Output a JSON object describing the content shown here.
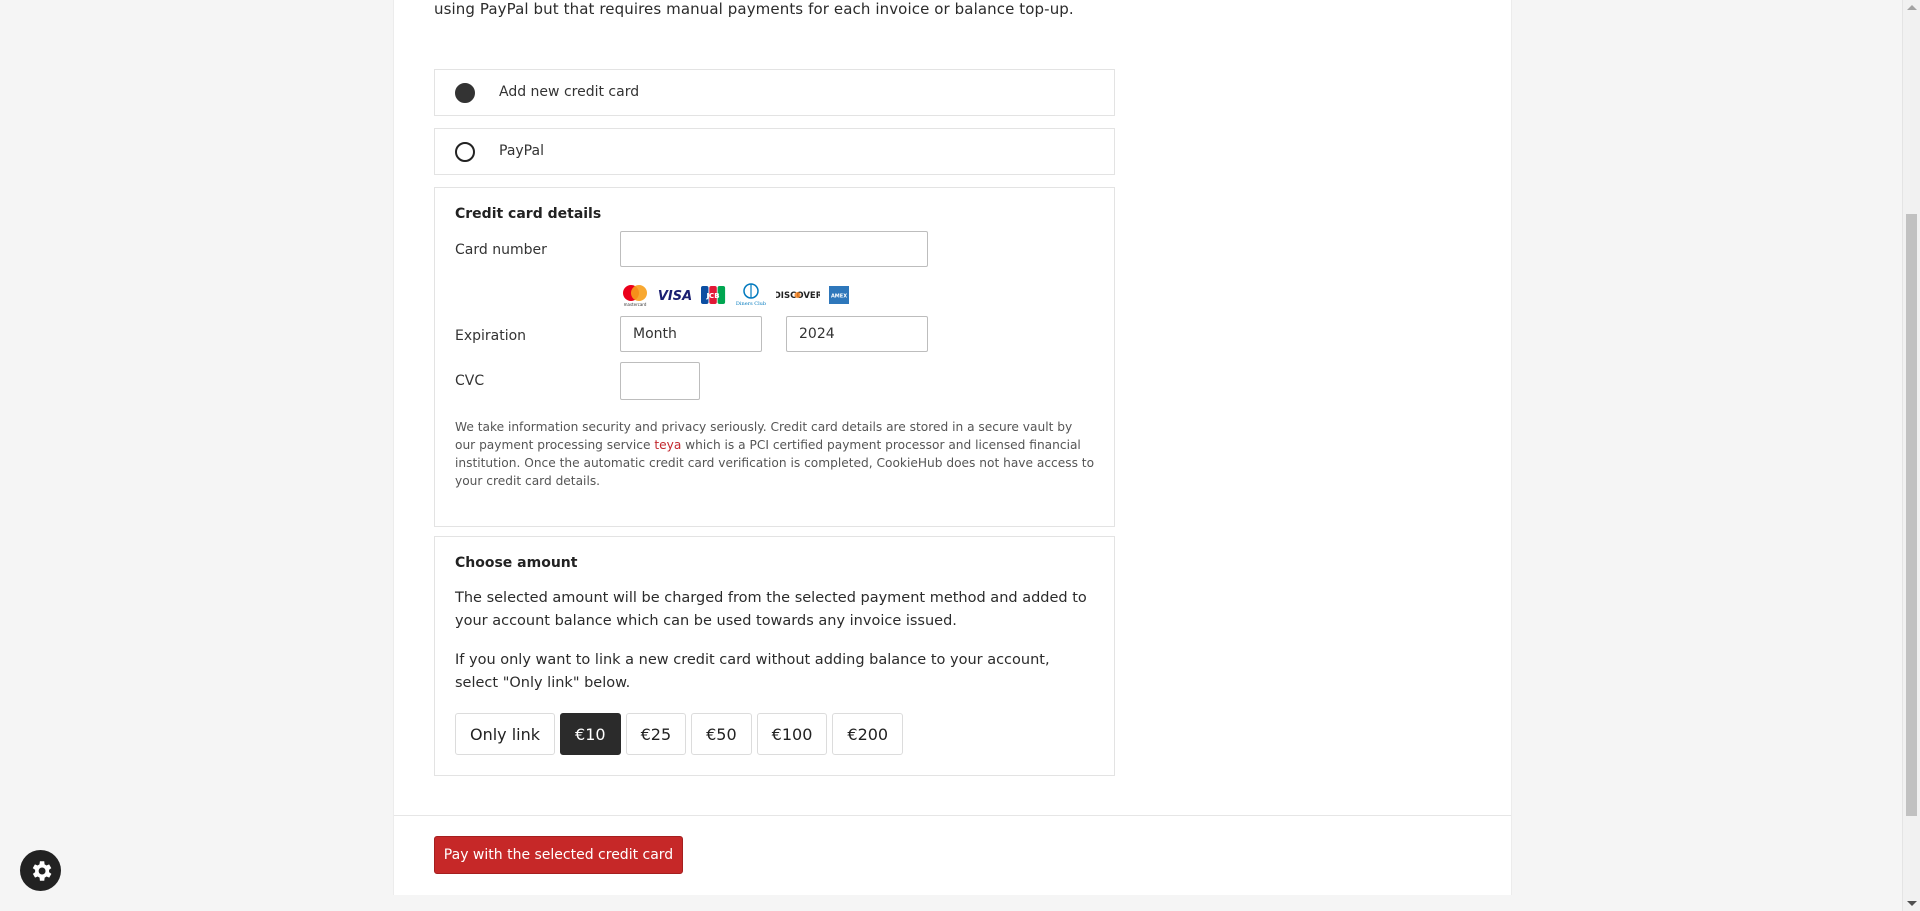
{
  "intro_text": "using PayPal but that requires manual payments for each invoice or balance top-up.",
  "payment_options": [
    {
      "label": "Add new credit card",
      "selected": true
    },
    {
      "label": "PayPal",
      "selected": false
    }
  ],
  "credit_card": {
    "heading": "Credit card details",
    "card_number_label": "Card number",
    "card_number_value": "",
    "expiration_label": "Expiration",
    "month_value": "Month",
    "year_value": "2024",
    "cvc_label": "CVC",
    "cvc_value": "",
    "card_brand_logos": [
      "mastercard-icon",
      "visa-icon",
      "jcb-icon",
      "diners-club-icon",
      "discover-icon",
      "american-express-icon"
    ],
    "logo_text": {
      "visa": "VISA",
      "jcb": "JCB",
      "diners": "Diners Club",
      "discover": "DISCOVER",
      "mastercard": "mastercard",
      "amex": "AMEX"
    },
    "notice_part1": "We take information security and privacy seriously. Credit card details are stored in a secure vault by our payment processing service ",
    "notice_brand": "teya",
    "notice_part2": " which is a PCI certified payment processor and licensed financial institution. Once the automatic credit card verification is completed, CookieHub does not have access to your credit card details."
  },
  "amount": {
    "heading": "Choose amount",
    "paragraph1": "The selected amount will be charged from the selected payment method and added to your account balance which can be used towards any invoice issued.",
    "paragraph2": "If you only want to link a new credit card without adding balance to your account, select \"Only link\" below.",
    "options": [
      "Only link",
      "€10",
      "€25",
      "€50",
      "€100",
      "€200"
    ],
    "selected": "€10"
  },
  "pay_button_label": "Pay with the selected credit card",
  "colors": {
    "brand_red": "#c62828",
    "selected_dark": "#2b2b2b",
    "teya_red": "#c2272d"
  },
  "floating_icon": "gear-icon"
}
